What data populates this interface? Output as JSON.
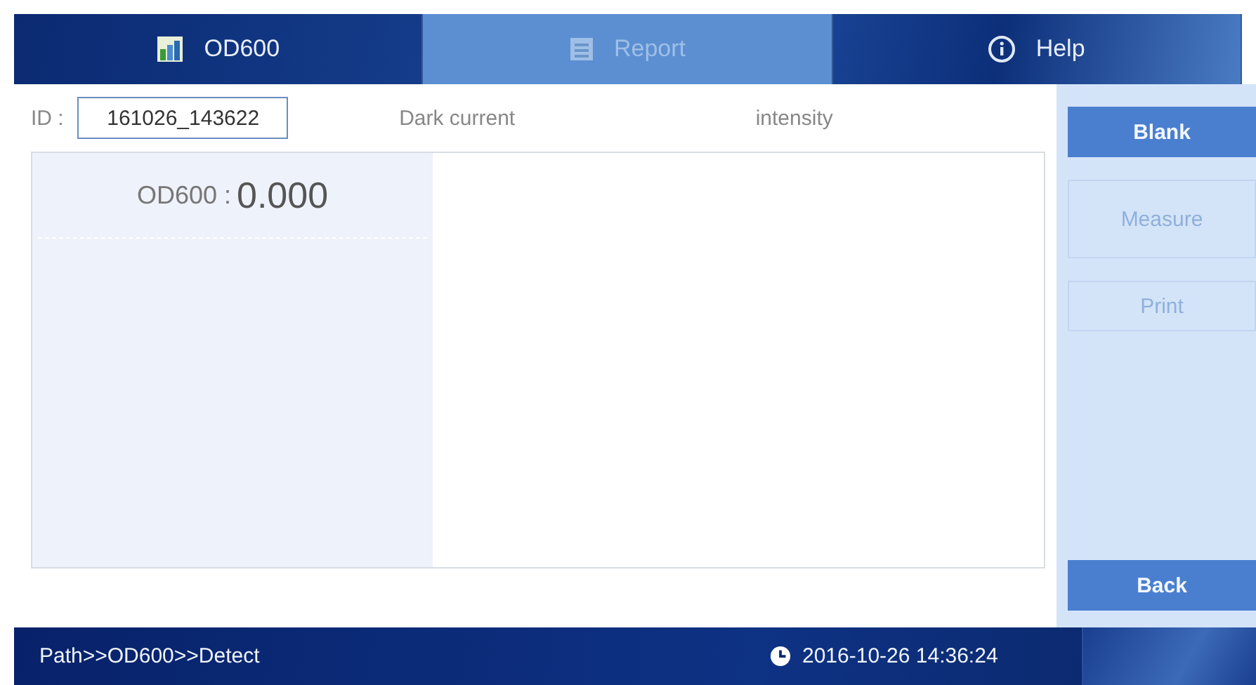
{
  "tabs": [
    {
      "label": "OD600",
      "disabled": false
    },
    {
      "label": "Report",
      "disabled": true
    },
    {
      "label": "Help",
      "disabled": false
    }
  ],
  "id_field": {
    "label": "ID :",
    "value": "161026_143622"
  },
  "columns": [
    "Dark current",
    "intensity"
  ],
  "reading": {
    "label": "OD600 :",
    "value": "0.000"
  },
  "buttons": [
    {
      "label": "Blank",
      "disabled": false
    },
    {
      "label": "Measure",
      "disabled": true
    },
    {
      "label": "Print",
      "disabled": true
    },
    {
      "label": "Back",
      "disabled": false
    }
  ],
  "status_bar": {
    "path": "Path>>OD600>>Detect",
    "datetime": "2016-10-26 14:36:24"
  }
}
